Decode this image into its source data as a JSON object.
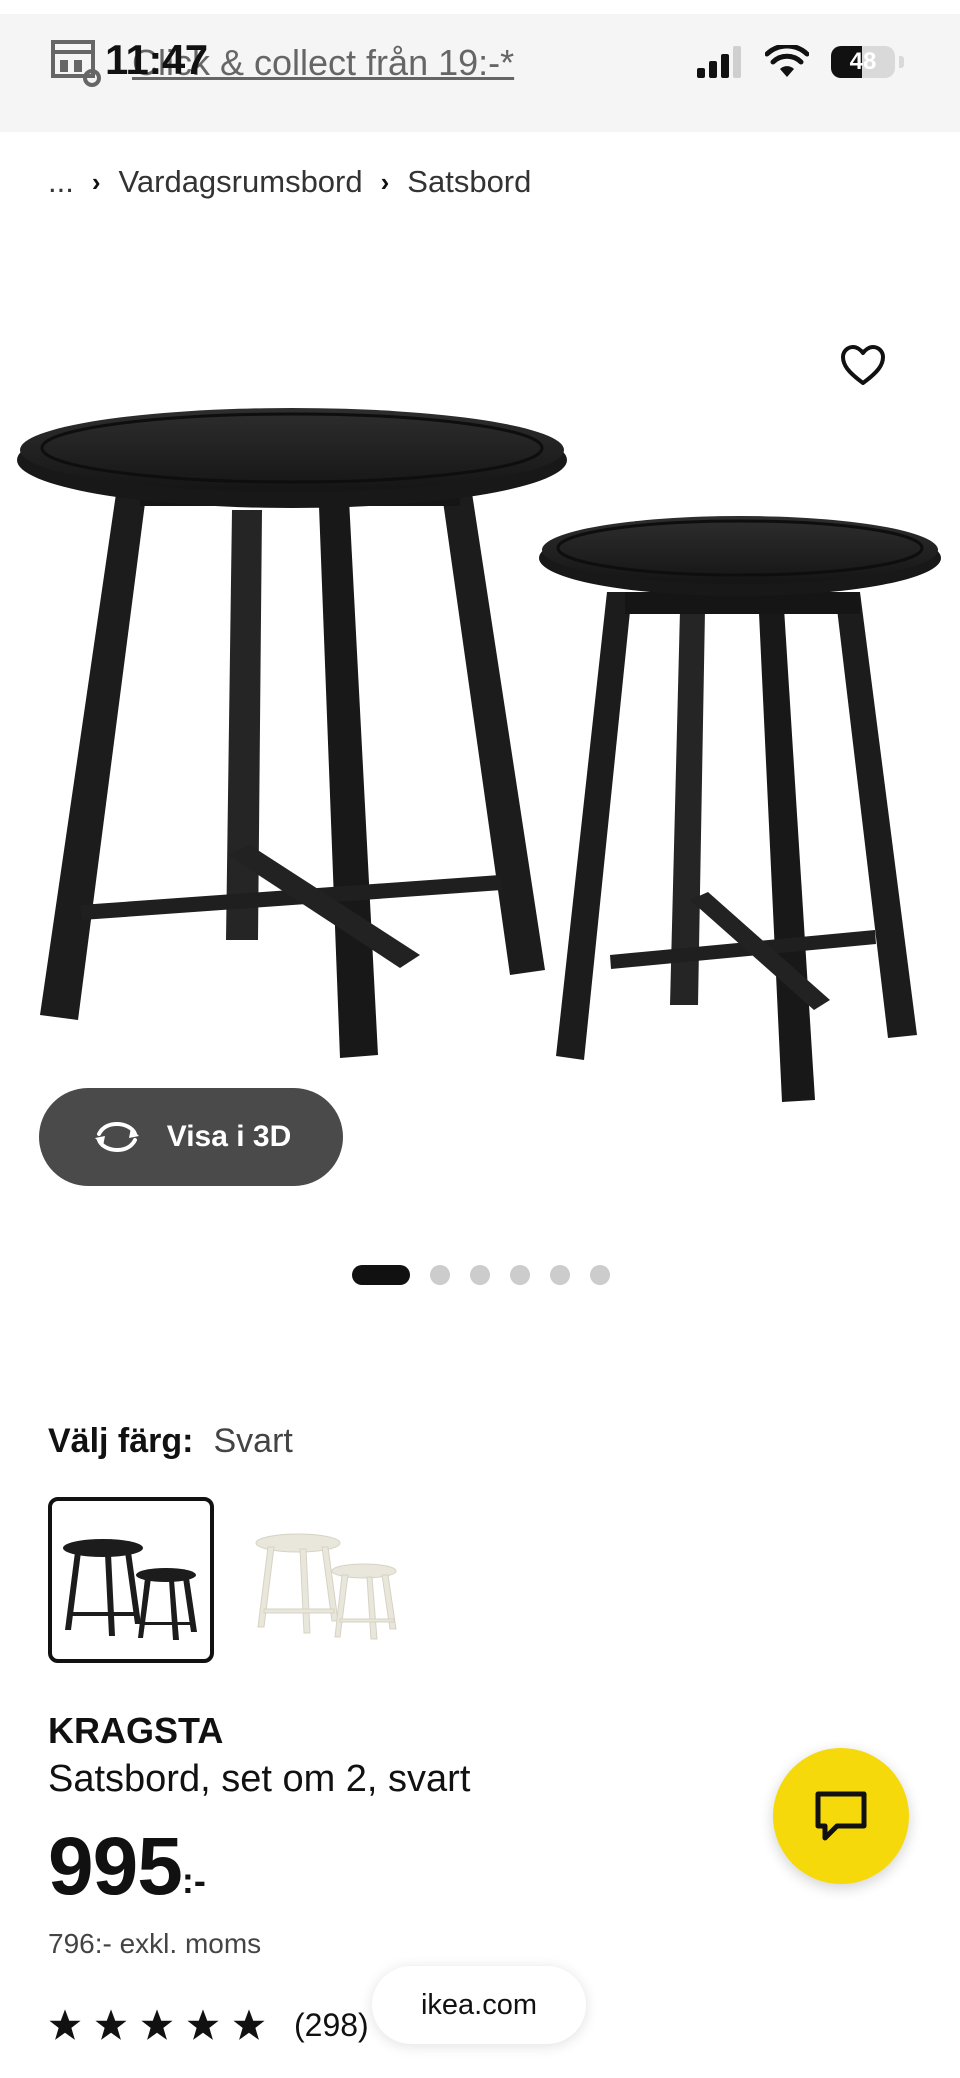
{
  "status_bar": {
    "time": "11:47",
    "battery_level": "48",
    "battery_fraction": 0.48,
    "icons": [
      "signal-icon",
      "wifi-icon",
      "battery-icon"
    ]
  },
  "promo": {
    "text": "Click & collect från 19:-*",
    "icon": "store-icon"
  },
  "breadcrumb": {
    "ellipsis": "...",
    "separator": "›",
    "items": [
      "Vardagsrumsbord",
      "Satsbord"
    ]
  },
  "gallery": {
    "view_3d_label": "Visa i 3D",
    "slide_count": 6,
    "active_slide": 1
  },
  "color_select": {
    "label": "Välj färg:",
    "selected": "Svart",
    "options": [
      "Svart",
      "Vit"
    ]
  },
  "product": {
    "name": "KRAGSTA",
    "description": "Satsbord, set om 2, svart",
    "price_integer": "995",
    "price_suffix": ":-",
    "price_ex_vat": "796:- exkl. moms",
    "rating_stars": 5,
    "rating_count": "(298)"
  },
  "browser": {
    "url": "ikea.com"
  },
  "colors": {
    "accent_yellow": "#f5d90a",
    "button_dark": "#4a4a4a",
    "table_black": "#1c1c1c",
    "table_white": "#efeee6"
  }
}
